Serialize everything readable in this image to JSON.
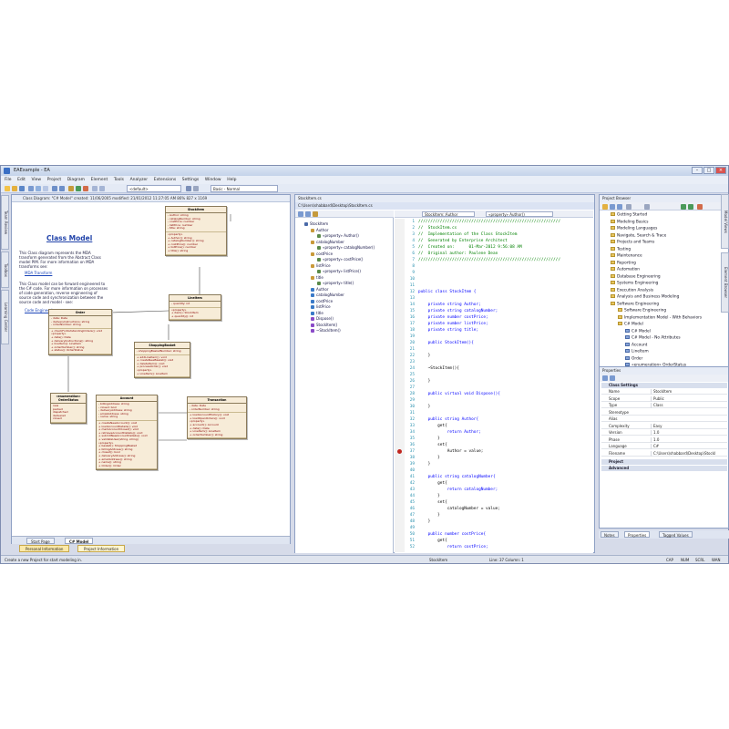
{
  "window": {
    "title": "EAExample - EA"
  },
  "menu": [
    "File",
    "Edit",
    "View",
    "Project",
    "Diagram",
    "Element",
    "Tools",
    "Analyzer",
    "Extensions",
    "Settings",
    "Window",
    "Help"
  ],
  "toolbar": {
    "perspective": "<default>",
    "workspace": "Basic - Normal"
  },
  "left_side_tabs": [
    "Toolbox",
    "Learning Center",
    "Team Review"
  ],
  "diagram": {
    "header": "Class Diagram: \"C# Model\"   created: 11/06/2005  modified: 21/01/2012 11:27:05 AM   86%   827 x 1169",
    "title": "Class Model",
    "note1": "This Class diagram represents the MDA transform generated from the Abstract Class model PIM. For more information on MDA transforms see:",
    "link1": "MDA Transform",
    "note2": "This Class model can be forward engineered to the C# code. For more information on processes of code generation, reverse engineering of source code and synchronization between the source code and model - see:",
    "link2": "Code Engineering",
    "classes": {
      "stockitem": {
        "name": "StockItem",
        "attrs": [
          "- Author: string",
          "- catalogNumber: string",
          "- costPrice: number",
          "- listPrice: number",
          "- title: string"
        ],
        "ops": [
          "«property»",
          "+ Author(): string",
          "+ catalogNumber(): string",
          "+ costPrice(): number",
          "+ listPrice(): number",
          "+ title(): string"
        ]
      },
      "order": {
        "name": "Order",
        "attrs": [
          "- date: Date",
          "- deliveryInstructions: string",
          "- orderNumber: string"
        ],
        "ops": [
          "+ checkForOutstandingOrders(): void",
          "«property»",
          "+ date(): Date",
          "+ deliveryInstructions(): string",
          "+ lineItem(): LineItem",
          "+ orderNumber(): string",
          "+ status(): OrderStatus"
        ]
      },
      "lineitem": {
        "name": "LineItem",
        "attrs": [
          "- quantity: int"
        ],
        "ops": [
          "«property»",
          "+ item(): StockItem",
          "+ quantity(): int"
        ]
      },
      "shoppingbasket": {
        "name": "ShoppingBasket",
        "attrs": [
          "- shoppingBasketNumber: string"
        ],
        "ops": [
          "+ addLineItem(): void",
          "+ createNewBasket(): void",
          "+ deleteItem(): void",
          "+ processOrder(): void",
          "«property»",
          "+ LineItem(): LineItem"
        ]
      },
      "orderstatus": {
        "name": "«enumeration» OrderStatus",
        "attrs": [
          "new",
          "packed",
          "dispatched",
          "delivered",
          "closed"
        ],
        "ops": []
      },
      "account": {
        "name": "Account",
        "attrs": [
          "- billingAddress: string",
          "- closed: bool",
          "- deliveryAddress: string",
          "- emailAddress: string",
          "- name: string"
        ],
        "ops": [
          "+ createNewAccount(): void",
          "+ loadAccountDetails(): void",
          "+ markAccountClosed(): void",
          "+ retrieveAccountDetails(): void",
          "+ submitNewAccountDetails(): void",
          "+ validateUser(string, string)",
          "«property»",
          "+ basket(): ShoppingBasket",
          "+ billingAddress(): string",
          "+ closed(): bool",
          "+ deliveryAddress(): string",
          "+ emailAddress(): string",
          "+ name(): string",
          "+ Order(): Order"
        ]
      },
      "transaction": {
        "name": "Transaction",
        "attrs": [
          "- date: Date",
          "- orderNumber: string"
        ],
        "ops": [
          "+ loadAccountHistory(): void",
          "+ loadOpenOrders(): void",
          "«property»",
          "+ account(): Account",
          "+ date(): Date",
          "+ LineItem(): LineItem",
          "+ orderNumber(): string"
        ]
      }
    },
    "tabs": [
      "Start Page",
      "C# Model"
    ]
  },
  "bottom_tabs": [
    "Personal Information",
    "Project Information"
  ],
  "code": {
    "window_title": "StockItem.cs",
    "path": "C:\\Users\\shabbard\\Desktop\\StockItem.cs",
    "class_combo": "StockItem::Author",
    "member_combo": "«property» Author()",
    "tree": [
      "StockItem",
      "Author",
      "«property» Author()",
      "catalogNumber",
      "«property» catalogNumber()",
      "costPrice",
      "«property» costPrice()",
      "listPrice",
      "«property» listPrice()",
      "title",
      "«property» title()",
      "Author",
      "catalogNumber",
      "costPrice",
      "listPrice",
      "title",
      "Dispose()",
      "StockItem()",
      "~StockItem()"
    ],
    "lines": [
      {
        "n": "1",
        "t": "///////////////////////////////////////////////////////////",
        "c": "cm"
      },
      {
        "n": "2",
        "t": "//  StockItem.cs",
        "c": "cm"
      },
      {
        "n": "3",
        "t": "//  Implementation of the Class StockItem",
        "c": "cm"
      },
      {
        "n": "4",
        "t": "//  Generated by Enterprise Architect",
        "c": "cm"
      },
      {
        "n": "5",
        "t": "//  Created on:      01-Mar-2012 9:56:08 AM",
        "c": "cm"
      },
      {
        "n": "6",
        "t": "//  Original author: Paulene Dean",
        "c": "cm"
      },
      {
        "n": "7",
        "t": "///////////////////////////////////////////////////////////",
        "c": "cm"
      },
      {
        "n": "8",
        "t": "",
        "c": "tx"
      },
      {
        "n": "9",
        "t": "",
        "c": "tx"
      },
      {
        "n": "10",
        "t": "",
        "c": "tx"
      },
      {
        "n": "11",
        "t": "",
        "c": "tx"
      },
      {
        "n": "12",
        "t": "public class StockItem {",
        "c": "kw"
      },
      {
        "n": "13",
        "t": "",
        "c": "tx"
      },
      {
        "n": "14",
        "t": "    private string Author;",
        "c": "kw"
      },
      {
        "n": "15",
        "t": "    private string catalogNumber;",
        "c": "kw"
      },
      {
        "n": "16",
        "t": "    private number costPrice;",
        "c": "kw"
      },
      {
        "n": "17",
        "t": "    private number listPrice;",
        "c": "kw"
      },
      {
        "n": "18",
        "t": "    private string title;",
        "c": "kw"
      },
      {
        "n": "19",
        "t": "",
        "c": "tx"
      },
      {
        "n": "20",
        "t": "    public StockItem(){",
        "c": "kw"
      },
      {
        "n": "21",
        "t": "",
        "c": "tx"
      },
      {
        "n": "22",
        "t": "    }",
        "c": "tx"
      },
      {
        "n": "23",
        "t": "",
        "c": "tx"
      },
      {
        "n": "24",
        "t": "    ~StockItem(){",
        "c": "tx"
      },
      {
        "n": "25",
        "t": "",
        "c": "tx"
      },
      {
        "n": "26",
        "t": "    }",
        "c": "tx"
      },
      {
        "n": "27",
        "t": "",
        "c": "tx"
      },
      {
        "n": "28",
        "t": "    public virtual void Dispose(){",
        "c": "kw"
      },
      {
        "n": "29",
        "t": "",
        "c": "tx"
      },
      {
        "n": "30",
        "t": "    }",
        "c": "tx"
      },
      {
        "n": "31",
        "t": "",
        "c": "tx"
      },
      {
        "n": "32",
        "t": "    public string Author{",
        "c": "kw"
      },
      {
        "n": "33",
        "t": "        get{",
        "c": "tx"
      },
      {
        "n": "34",
        "t": "            return Author;",
        "c": "kw"
      },
      {
        "n": "35",
        "t": "        }",
        "c": "tx"
      },
      {
        "n": "36",
        "t": "        set{",
        "c": "tx"
      },
      {
        "n": "37",
        "t": "            Author = value;",
        "c": "tx"
      },
      {
        "n": "38",
        "t": "        }",
        "c": "tx"
      },
      {
        "n": "39",
        "t": "    }",
        "c": "tx"
      },
      {
        "n": "40",
        "t": "",
        "c": "tx"
      },
      {
        "n": "41",
        "t": "    public string catalogNumber{",
        "c": "kw"
      },
      {
        "n": "42",
        "t": "        get{",
        "c": "tx"
      },
      {
        "n": "43",
        "t": "            return catalogNumber;",
        "c": "kw"
      },
      {
        "n": "44",
        "t": "        }",
        "c": "tx"
      },
      {
        "n": "45",
        "t": "        set{",
        "c": "tx"
      },
      {
        "n": "46",
        "t": "            catalogNumber = value;",
        "c": "tx"
      },
      {
        "n": "47",
        "t": "        }",
        "c": "tx"
      },
      {
        "n": "48",
        "t": "    }",
        "c": "tx"
      },
      {
        "n": "49",
        "t": "",
        "c": "tx"
      },
      {
        "n": "50",
        "t": "    public number costPrice{",
        "c": "kw"
      },
      {
        "n": "51",
        "t": "        get{",
        "c": "tx"
      },
      {
        "n": "52",
        "t": "            return costPrice;",
        "c": "kw"
      }
    ]
  },
  "project_browser": {
    "title": "Project Browser",
    "items": [
      "Getting Started",
      "Modeling Basics",
      "Modeling Languages",
      "Navigate, Search & Trace",
      "Projects and Teams",
      "Testing",
      "Maintenance",
      "Reporting",
      "Automation",
      "Database Engineering",
      "Systems Engineering",
      "Execution Analysis",
      "Analysis and Business Modeling",
      "Software Engineering",
      "Software Engineering",
      "Implementation Model - With Behaviors",
      "C# Model",
      "C# Model",
      "C# Model - No Attributes",
      "Account",
      "LineItem",
      "Order",
      "«enumeration» OrderStatus",
      "ShoppingBasket",
      "StockItem",
      "Transaction"
    ]
  },
  "properties": {
    "title": "Properties",
    "section_class": "Class Settings",
    "rows": [
      [
        "Name",
        "StockItem"
      ],
      [
        "Scope",
        "Public"
      ],
      [
        "Type",
        "Class"
      ],
      [
        "Stereotype",
        ""
      ],
      [
        "Alias",
        ""
      ],
      [
        "Complexity",
        "Easy"
      ],
      [
        "Version",
        "1.0"
      ],
      [
        "Phase",
        "1.0"
      ],
      [
        "Language",
        "C#"
      ],
      [
        "Filename",
        "C:\\Users\\shabbard\\Desktop\\StockI"
      ]
    ],
    "section_project": "Project",
    "section_advanced": "Advanced",
    "tabs": [
      "Notes",
      "Properties",
      "Tagged Values"
    ]
  },
  "right_side_tabs": [
    "Model Views",
    "Element Browser"
  ],
  "status": {
    "left": "Create a new Project for start modeling in.",
    "file": "StockItem",
    "pos": "Line: 37 Column: 1",
    "flags": [
      "CAP",
      "NUM",
      "SCRL",
      "WAN"
    ]
  }
}
